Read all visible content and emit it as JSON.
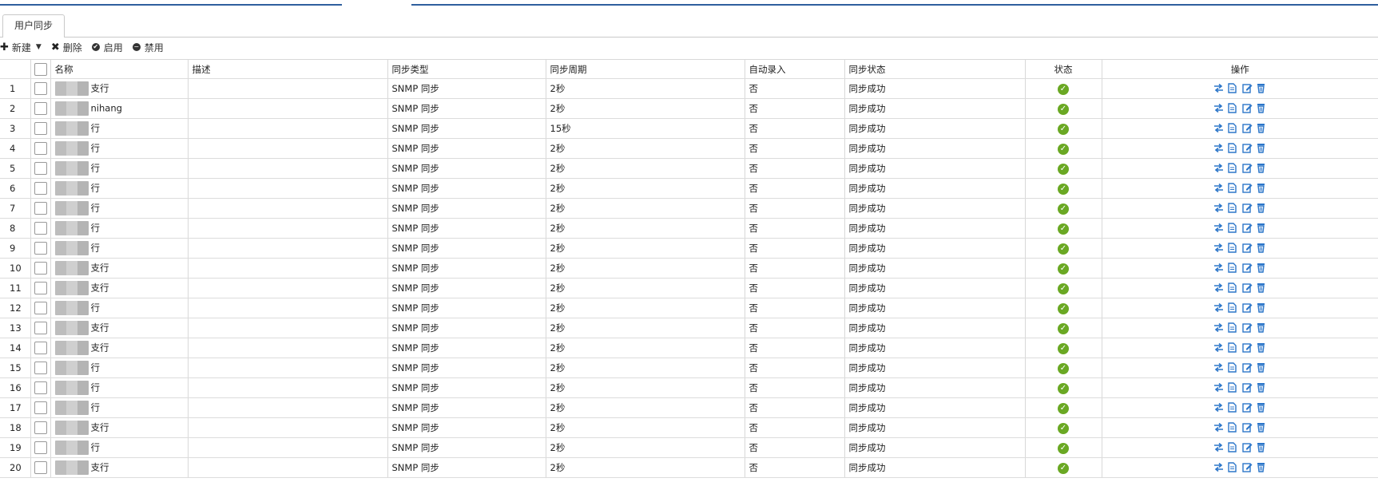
{
  "tab": {
    "label": "用户同步"
  },
  "toolbar": {
    "new_label": "新建",
    "delete_label": "删除",
    "enable_label": "启用",
    "disable_label": "禁用"
  },
  "columns": {
    "name": "名称",
    "desc": "描述",
    "sync_type": "同步类型",
    "sync_period": "同步周期",
    "auto_entry": "自动录入",
    "sync_status": "同步状态",
    "status": "状态",
    "actions": "操作"
  },
  "rows": [
    {
      "num": "1",
      "name": "支行",
      "desc": "",
      "type": "SNMP 同步",
      "period": "2秒",
      "auto": "否",
      "sync_status": "同步成功"
    },
    {
      "num": "2",
      "name": "nihang",
      "desc": "",
      "type": "SNMP 同步",
      "period": "2秒",
      "auto": "否",
      "sync_status": "同步成功"
    },
    {
      "num": "3",
      "name": "行",
      "desc": "",
      "type": "SNMP 同步",
      "period": "15秒",
      "auto": "否",
      "sync_status": "同步成功"
    },
    {
      "num": "4",
      "name": "行",
      "desc": "",
      "type": "SNMP 同步",
      "period": "2秒",
      "auto": "否",
      "sync_status": "同步成功"
    },
    {
      "num": "5",
      "name": "行",
      "desc": "",
      "type": "SNMP 同步",
      "period": "2秒",
      "auto": "否",
      "sync_status": "同步成功"
    },
    {
      "num": "6",
      "name": "行",
      "desc": "",
      "type": "SNMP 同步",
      "period": "2秒",
      "auto": "否",
      "sync_status": "同步成功"
    },
    {
      "num": "7",
      "name": "行",
      "desc": "",
      "type": "SNMP 同步",
      "period": "2秒",
      "auto": "否",
      "sync_status": "同步成功"
    },
    {
      "num": "8",
      "name": "行",
      "desc": "",
      "type": "SNMP 同步",
      "period": "2秒",
      "auto": "否",
      "sync_status": "同步成功"
    },
    {
      "num": "9",
      "name": "行",
      "desc": "",
      "type": "SNMP 同步",
      "period": "2秒",
      "auto": "否",
      "sync_status": "同步成功"
    },
    {
      "num": "10",
      "name": "支行",
      "desc": "",
      "type": "SNMP 同步",
      "period": "2秒",
      "auto": "否",
      "sync_status": "同步成功"
    },
    {
      "num": "11",
      "name": "支行",
      "desc": "",
      "type": "SNMP 同步",
      "period": "2秒",
      "auto": "否",
      "sync_status": "同步成功"
    },
    {
      "num": "12",
      "name": "行",
      "desc": "",
      "type": "SNMP 同步",
      "period": "2秒",
      "auto": "否",
      "sync_status": "同步成功"
    },
    {
      "num": "13",
      "name": "支行",
      "desc": "",
      "type": "SNMP 同步",
      "period": "2秒",
      "auto": "否",
      "sync_status": "同步成功"
    },
    {
      "num": "14",
      "name": "支行",
      "desc": "",
      "type": "SNMP 同步",
      "period": "2秒",
      "auto": "否",
      "sync_status": "同步成功"
    },
    {
      "num": "15",
      "name": "行",
      "desc": "",
      "type": "SNMP 同步",
      "period": "2秒",
      "auto": "否",
      "sync_status": "同步成功"
    },
    {
      "num": "16",
      "name": "行",
      "desc": "",
      "type": "SNMP 同步",
      "period": "2秒",
      "auto": "否",
      "sync_status": "同步成功"
    },
    {
      "num": "17",
      "name": "行",
      "desc": "",
      "type": "SNMP 同步",
      "period": "2秒",
      "auto": "否",
      "sync_status": "同步成功"
    },
    {
      "num": "18",
      "name": "支行",
      "desc": "",
      "type": "SNMP 同步",
      "period": "2秒",
      "auto": "否",
      "sync_status": "同步成功"
    },
    {
      "num": "19",
      "name": "行",
      "desc": "",
      "type": "SNMP 同步",
      "period": "2秒",
      "auto": "否",
      "sync_status": "同步成功"
    },
    {
      "num": "20",
      "name": "支行",
      "desc": "",
      "type": "SNMP 同步",
      "period": "2秒",
      "auto": "否",
      "sync_status": "同步成功"
    }
  ],
  "icons": {
    "status": "check-circle-icon",
    "actions": [
      "sync-arrows-icon",
      "document-icon",
      "edit-icon",
      "trash-icon"
    ]
  },
  "colors": {
    "accent": "#2f5f9e",
    "ok_green": "#6aa823",
    "action_blue": "#2c76c9"
  }
}
